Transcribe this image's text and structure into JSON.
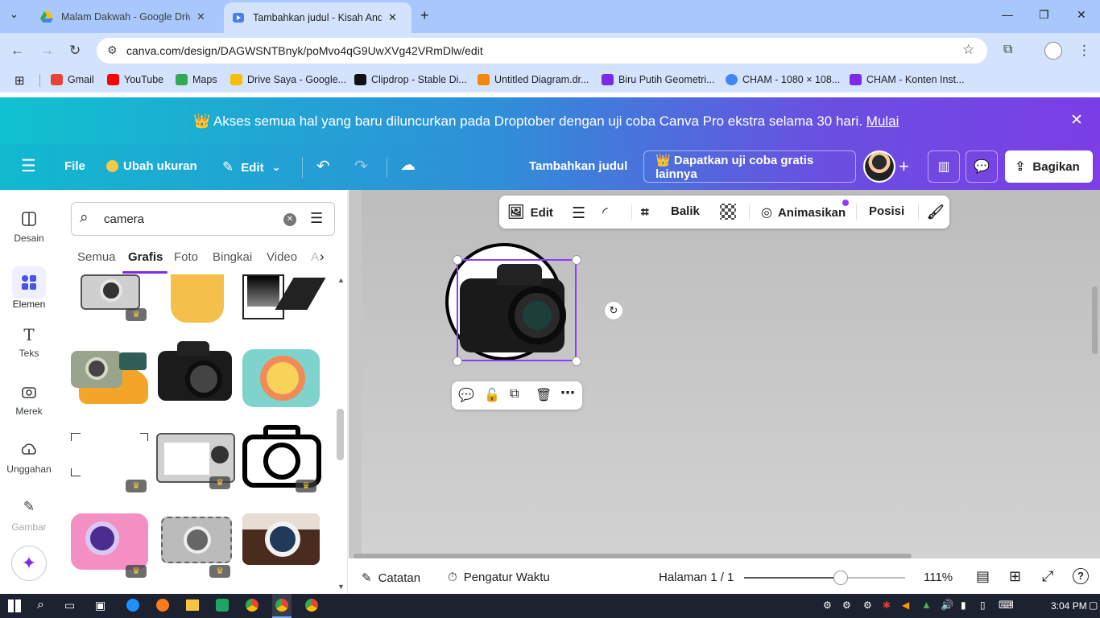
{
  "browser": {
    "tabs": [
      {
        "title": "Malam Dakwah - Google Drive",
        "icon": "google-drive-icon",
        "active": false
      },
      {
        "title": "Tambahkan judul - Kisah Anda",
        "icon": "canva-icon",
        "active": true
      }
    ],
    "new_tab": "+",
    "url": "canva.com/design/DAGWSNTBnyk/poMvo4qG9UwXVg42VRmDlw/edit",
    "bookmarks": [
      {
        "label": "Gmail",
        "color": "#ea4335"
      },
      {
        "label": "YouTube",
        "color": "#ff0000"
      },
      {
        "label": "Maps",
        "color": "#34a853"
      },
      {
        "label": "Drive Saya - Google...",
        "color": "#fbbc04"
      },
      {
        "label": "Clipdrop - Stable Di...",
        "color": "#111111"
      },
      {
        "label": "Untitled Diagram.dr...",
        "color": "#f08705"
      },
      {
        "label": "Biru Putih Geometri...",
        "color": "#7d2ae8"
      },
      {
        "label": "CHAM - 1080 × 108...",
        "color": "#4285f4"
      },
      {
        "label": "CHAM - Konten Inst...",
        "color": "#7d2ae8"
      }
    ]
  },
  "banner": {
    "text": "👑 Akses semua hal yang baru diluncurkan pada Droptober dengan uji coba Canva Pro ekstra selama 30 hari.",
    "link": "Mulai",
    "close": "✕"
  },
  "topbar": {
    "menu": "☰",
    "file": "File",
    "resize": "Ubah ukuran",
    "edit": "Edit",
    "title": "Tambahkan judul",
    "trial": "👑 Dapatkan uji coba gratis lainnya",
    "share": "Bagikan",
    "plus": "+"
  },
  "rail": [
    {
      "label": "Desain",
      "icon": "design-icon"
    },
    {
      "label": "Elemen",
      "icon": "elements-icon"
    },
    {
      "label": "Teks",
      "icon": "text-icon"
    },
    {
      "label": "Merek",
      "icon": "brand-icon"
    },
    {
      "label": "Unggahan",
      "icon": "upload-icon"
    },
    {
      "label": "Gambar",
      "icon": "draw-icon"
    }
  ],
  "panel": {
    "search_value": "camera",
    "tabs": [
      "Semua",
      "Grafis",
      "Foto",
      "Bingkai",
      "Video",
      "A"
    ],
    "active_tab": "Grafis"
  },
  "floatbar": {
    "edit": "Edit",
    "flip": "Balik",
    "animate": "Animasikan",
    "position": "Posisi"
  },
  "footer": {
    "notes": "Catatan",
    "timer": "Pengatur Waktu",
    "page": "Halaman 1 / 1",
    "zoom": "111%",
    "zoom_fraction": 0.6
  },
  "taskbar": {
    "time": "3:04 PM"
  }
}
